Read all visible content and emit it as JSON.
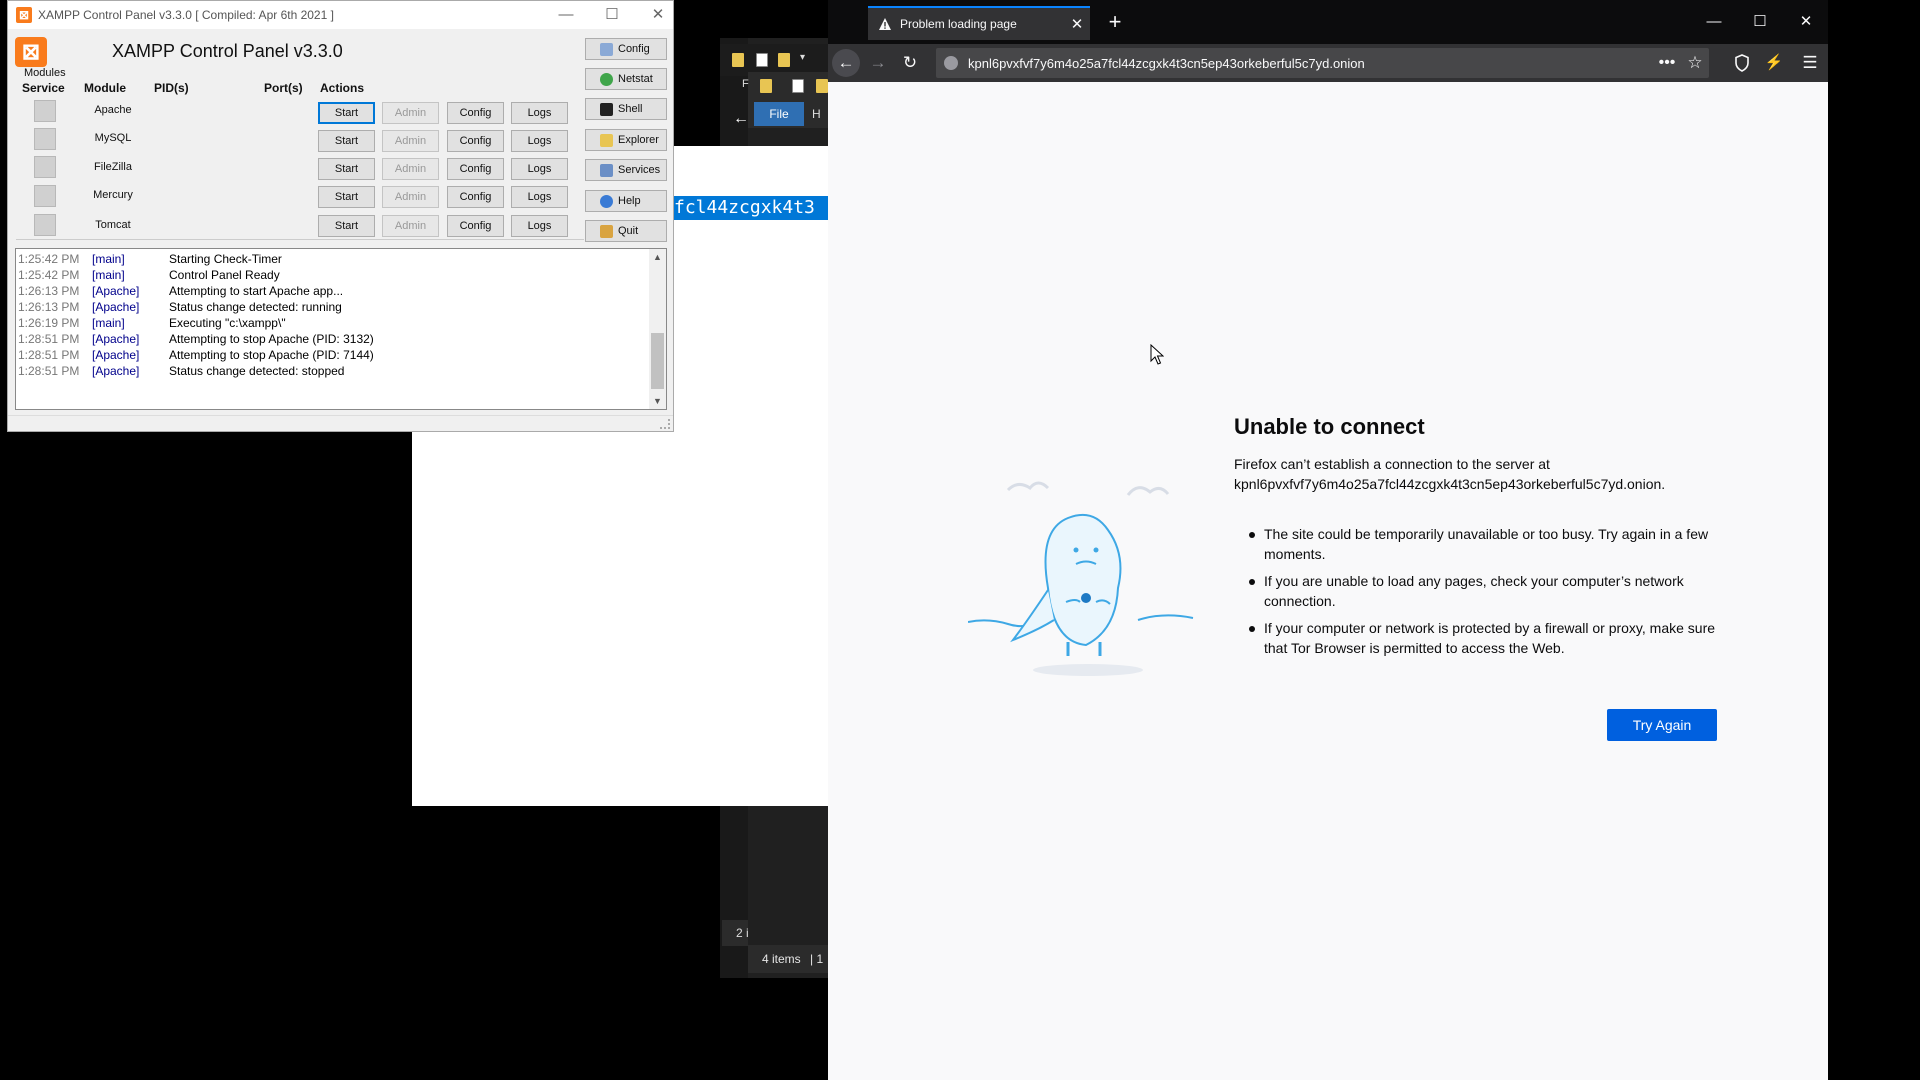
{
  "xampp": {
    "window_title": "XAMPP Control Panel v3.3.0   [ Compiled: Apr 6th 2021 ]",
    "heading": "XAMPP Control Panel v3.3.0",
    "modules_label": "Modules",
    "headers": {
      "service": "Service",
      "module": "Module",
      "pids": "PID(s)",
      "ports": "Port(s)",
      "actions": "Actions"
    },
    "modules": [
      {
        "name": "Apache",
        "start": "Start",
        "admin": "Admin",
        "config": "Config",
        "logs": "Logs"
      },
      {
        "name": "MySQL",
        "start": "Start",
        "admin": "Admin",
        "config": "Config",
        "logs": "Logs"
      },
      {
        "name": "FileZilla",
        "start": "Start",
        "admin": "Admin",
        "config": "Config",
        "logs": "Logs"
      },
      {
        "name": "Mercury",
        "start": "Start",
        "admin": "Admin",
        "config": "Config",
        "logs": "Logs"
      },
      {
        "name": "Tomcat",
        "start": "Start",
        "admin": "Admin",
        "config": "Config",
        "logs": "Logs"
      }
    ],
    "side_buttons": {
      "config": "Config",
      "netstat": "Netstat",
      "shell": "Shell",
      "explorer": "Explorer",
      "services": "Services",
      "help": "Help",
      "quit": "Quit"
    },
    "log": [
      {
        "time": "1:25:42 PM",
        "module": "[main]",
        "message": "Starting Check-Timer"
      },
      {
        "time": "1:25:42 PM",
        "module": "[main]",
        "message": "Control Panel Ready"
      },
      {
        "time": "1:26:13 PM",
        "module": "[Apache]",
        "message": "Attempting to start Apache app..."
      },
      {
        "time": "1:26:13 PM",
        "module": "[Apache]",
        "message": "Status change detected: running"
      },
      {
        "time": "1:26:19 PM",
        "module": "[main]",
        "message": "Executing \"c:\\xampp\\\""
      },
      {
        "time": "1:28:51 PM",
        "module": "[Apache]",
        "message": "Attempting to stop Apache (PID: 3132)"
      },
      {
        "time": "1:28:51 PM",
        "module": "[Apache]",
        "message": "Attempting to stop Apache (PID: 7144)"
      },
      {
        "time": "1:28:51 PM",
        "module": "[Apache]",
        "message": "Status change detected: stopped"
      }
    ]
  },
  "explorer": {
    "file_tab": "File",
    "home_tab": "H",
    "f_label": "F",
    "items_count": "4 items",
    "status_sep": "|  1",
    "left_status": "2 i"
  },
  "notepad": {
    "selected_text": "fcl44zcgxk4t3"
  },
  "browser": {
    "tab_title": "Problem loading page",
    "url": "kpnl6pvxfvf7y6m4o25a7fcl44zcgxk4t3cn5ep43orkeberful5c7yd.onion",
    "error_title": "Unable to connect",
    "error_desc_line1": "Firefox can’t establish a connection to the server at",
    "error_desc_line2": "kpnl6pvxfvf7y6m4o25a7fcl44zcgxk4t3cn5ep43orkeberful5c7yd.onion.",
    "error_items": [
      "The site could be temporarily unavailable or too busy. Try again in a few moments.",
      "If you are unable to load any pages, check your computer’s network connection.",
      "If your computer or network is protected by a firewall or proxy, make sure that Tor Browser is permitted to access the Web."
    ],
    "try_again": "Try Again"
  },
  "colors": {
    "xampp_orange": "#f97b1c",
    "selection_blue": "#0078d7",
    "firefox_blue": "#0060df",
    "tab_accent": "#0a84ff",
    "log_module": "#00008b"
  },
  "icons": {
    "tab": "warning-icon",
    "url": "info-icon",
    "shield": "shield-icon",
    "tor": "tor-onion-icon",
    "menu": "hamburger-menu-icon"
  }
}
